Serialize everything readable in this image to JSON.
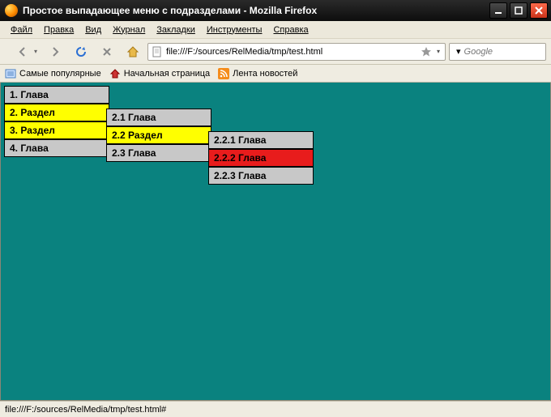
{
  "window": {
    "title": "Простое выпадающее меню с подразделами - Mozilla Firefox"
  },
  "menubar": {
    "file": "Файл",
    "edit": "Правка",
    "view": "Вид",
    "history": "Журнал",
    "bookmarks": "Закладки",
    "tools": "Инструменты",
    "help": "Справка"
  },
  "navbar": {
    "url": "file:///F:/sources/RelMedia/tmp/test.html",
    "search_placeholder": "Google"
  },
  "bookmarks_bar": {
    "popular": "Самые популярные",
    "start": "Начальная страница",
    "news": "Лента новостей"
  },
  "dropdown": {
    "level1": [
      {
        "label": "1. Глава",
        "state": "normal"
      },
      {
        "label": "2. Раздел",
        "state": "yellow"
      },
      {
        "label": "3. Раздел",
        "state": "yellow"
      },
      {
        "label": "4. Глава",
        "state": "normal"
      }
    ],
    "level2": [
      {
        "label": "2.1 Глава",
        "state": "normal"
      },
      {
        "label": "2.2 Раздел",
        "state": "yellow"
      },
      {
        "label": "2.3 Глава",
        "state": "normal"
      }
    ],
    "level3": [
      {
        "label": "2.2.1 Глава",
        "state": "normal"
      },
      {
        "label": "2.2.2 Глава",
        "state": "red"
      },
      {
        "label": "2.2.3 Глава",
        "state": "normal"
      }
    ]
  },
  "statusbar": {
    "text": "file:///F:/sources/RelMedia/tmp/test.html#"
  }
}
